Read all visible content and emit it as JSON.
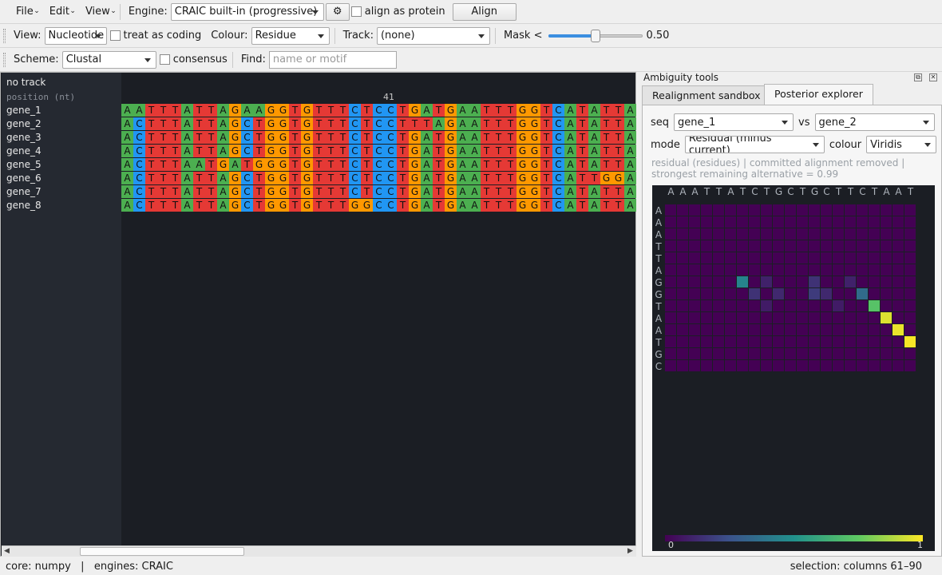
{
  "menubar": {
    "menus": [
      "File",
      "Edit",
      "View"
    ],
    "engine_label": "Engine:",
    "engine_value": "CRAIC built-in (progressive)",
    "settings_icon": "gear-icon",
    "protein_label": "align as protein",
    "align_button": "Align"
  },
  "viewbar": {
    "view_label": "View:",
    "view_value": "Nucleotide",
    "coding_label": "treat as coding",
    "colour_label": "Colour:",
    "colour_value": "Residue",
    "track_label": "Track:",
    "track_value": "(none)",
    "mask_label": "Mask <",
    "mask_level": 0.5,
    "mask_value": "0.50"
  },
  "schemebar": {
    "scheme_label": "Scheme:",
    "scheme_value": "Clustal",
    "consensus_label": "consensus",
    "find_label": "Find:",
    "find_placeholder": "name or motif"
  },
  "alignment": {
    "track_header": "no track",
    "position_header": "position (nt)",
    "position_marker": "41",
    "position_marker_column": 22,
    "residue_colors": {
      "A": "#4caf50",
      "C": "#2196f3",
      "G": "#ff9800",
      "T": "#e53935"
    },
    "rows": [
      {
        "name": "gene_1",
        "seq": "AATTTATTAGAAGGTGTTTCTCCTGATGAATTTGGTCATATTA"
      },
      {
        "name": "gene_2",
        "seq": "ACTTTATTAGCTGGTGTTTCTCCTTTAGAATTTGGTCATATTA"
      },
      {
        "name": "gene_3",
        "seq": "ACTTTATTAGCTGGTGTTTCTCCTGATGAATTTGGTCATATTA"
      },
      {
        "name": "gene_4",
        "seq": "ACTTTATTAGCTGGTGTTTCTCCTGATGAATTTGGTCATATTA"
      },
      {
        "name": "gene_5",
        "seq": "ACTTTAATGATGGGTGTTTCTCCTGATGAATTTGGTCATATTA"
      },
      {
        "name": "gene_6",
        "seq": "ACTTTATTAGCTGGTGTTTCTCCTGATGAATTTGGTCATTGGA"
      },
      {
        "name": "gene_7",
        "seq": "ACTTTATTAGCTGGTGTTTCTCCTGATGAATTTGGTCATATTA"
      },
      {
        "name": "gene_8",
        "seq": "ACTTTATTAGCTGGTGTTTGGCCTGATGAATTTGGTCATATTA"
      }
    ]
  },
  "dock": {
    "title": "Ambiguity tools",
    "tabs": [
      "Realignment sandbox",
      "Posterior explorer"
    ],
    "active_tab": 1,
    "seq_label": "seq",
    "seq_value": "gene_1",
    "vs_label": "vs",
    "vs_value": "gene_2",
    "mode_label": "mode",
    "mode_value": "Residual (minus current)",
    "colour_label": "colour",
    "colour_value": "Viridis",
    "info_line1": "residual (residues)  |  committed alignment removed  |",
    "info_line2": "strongest remaining alternative = 0.99",
    "heatmap": {
      "col_labels": [
        "A",
        "A",
        "A",
        "T",
        "T",
        "A",
        "T",
        "C",
        "T",
        "G",
        "C",
        "T",
        "G",
        "C",
        "T",
        "T",
        "C",
        "T",
        "A",
        "A",
        "T"
      ],
      "row_labels": [
        "A",
        "A",
        "A",
        "T",
        "T",
        "A",
        "G",
        "G",
        "T",
        "A",
        "A",
        "T",
        "G",
        "C"
      ],
      "cells": [
        {
          "r": 6,
          "c": 6,
          "v": 0.45
        },
        {
          "r": 6,
          "c": 8,
          "v": 0.1
        },
        {
          "r": 6,
          "c": 12,
          "v": 0.15
        },
        {
          "r": 6,
          "c": 15,
          "v": 0.1
        },
        {
          "r": 7,
          "c": 7,
          "v": 0.15
        },
        {
          "r": 7,
          "c": 9,
          "v": 0.12
        },
        {
          "r": 7,
          "c": 12,
          "v": 0.18
        },
        {
          "r": 7,
          "c": 13,
          "v": 0.12
        },
        {
          "r": 7,
          "c": 16,
          "v": 0.35
        },
        {
          "r": 8,
          "c": 8,
          "v": 0.08
        },
        {
          "r": 8,
          "c": 14,
          "v": 0.08
        },
        {
          "r": 8,
          "c": 17,
          "v": 0.72
        },
        {
          "r": 9,
          "c": 18,
          "v": 0.95
        },
        {
          "r": 10,
          "c": 19,
          "v": 0.97
        },
        {
          "r": 11,
          "c": 20,
          "v": 0.99
        }
      ],
      "scale_min": "0",
      "scale_max": "1"
    }
  },
  "status": {
    "left": "core: numpy   |   engines: CRAIC",
    "right": "selection: columns 61–90"
  }
}
